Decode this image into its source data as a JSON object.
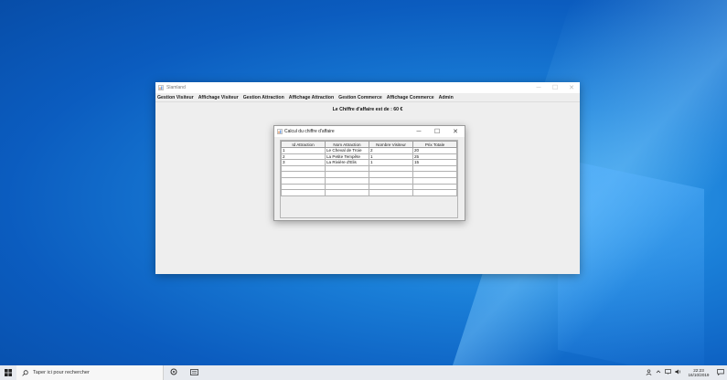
{
  "main_window": {
    "title": "Slamland",
    "menus": [
      "Gestion Visiteur",
      "Affichage Visiteur",
      "Gestion Attraction",
      "Affichage Attraction",
      "Gestion Commerce",
      "Affichage Commerce",
      "Admin"
    ],
    "revenue_text": "Le Chiffre d'affaire est de : 60 €",
    "controls": {
      "minimize": "─",
      "maximize": "☐",
      "close": "✕"
    }
  },
  "dialog": {
    "title": "Calcul du chiffre d'affaire",
    "controls": {
      "minimize": "─",
      "maximize": "☐",
      "close": "✕"
    },
    "columns": [
      "Id Attraction",
      "Nom Attraction",
      "Nombre Visiteur",
      "Prix Totale"
    ],
    "rows": [
      [
        "1",
        "Le Cheval de Troie",
        "2",
        "20"
      ],
      [
        "2",
        "La Petite Tempête",
        "1",
        "25"
      ],
      [
        "3",
        "La Rivière d'Elis",
        "1",
        "15"
      ],
      [
        "",
        "",
        "",
        ""
      ],
      [
        "",
        "",
        "",
        ""
      ],
      [
        "",
        "",
        "",
        ""
      ],
      [
        "",
        "",
        "",
        ""
      ],
      [
        "",
        "",
        "",
        ""
      ]
    ]
  },
  "taskbar": {
    "search_placeholder": "Taper ici pour rechercher",
    "time": "22:23",
    "date": "16/10/2019",
    "icons": [
      "windows-start-icon",
      "search-icon",
      "task-view-icon",
      "file-explorer-icon",
      "people-icon",
      "chevron-up-icon",
      "network-icon",
      "volume-icon",
      "notification-icon"
    ]
  },
  "colors": {
    "desktop": "#0b5cbf",
    "window_bg": "#eeeeee",
    "taskbar": "#e7eaef"
  }
}
